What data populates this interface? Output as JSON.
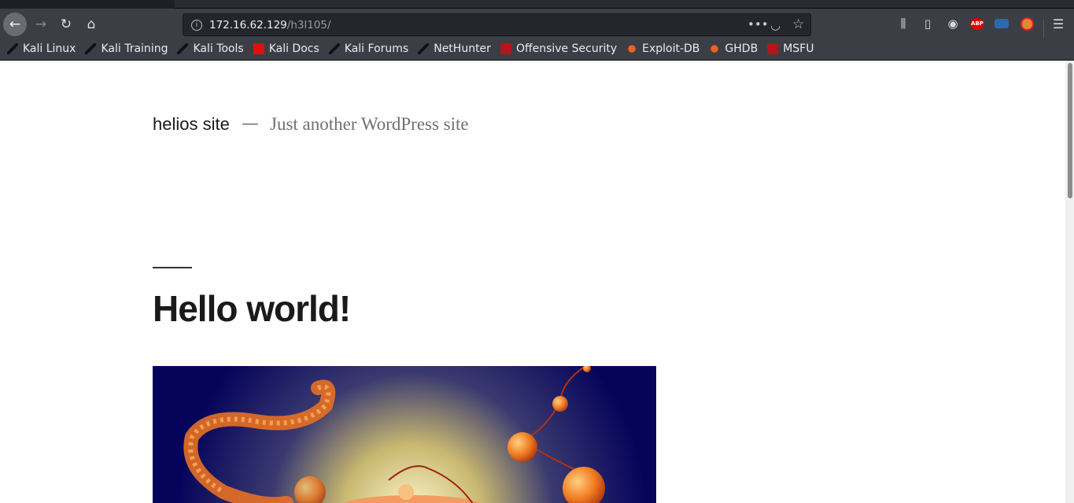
{
  "browser": {
    "url_host": "172.16.62.129",
    "url_path": "/h3l105/",
    "bookmarks": [
      {
        "label": "Kali Linux",
        "icon": "kali-dragon-icon"
      },
      {
        "label": "Kali Training",
        "icon": "kali-dragon-icon"
      },
      {
        "label": "Kali Tools",
        "icon": "kali-dragon-icon"
      },
      {
        "label": "Kali Docs",
        "icon": "kali-docs-icon"
      },
      {
        "label": "Kali Forums",
        "icon": "kali-dragon-icon"
      },
      {
        "label": "NetHunter",
        "icon": "kali-dragon-icon"
      },
      {
        "label": "Offensive Security",
        "icon": "offsec-icon"
      },
      {
        "label": "Exploit-DB",
        "icon": "exploit-db-icon"
      },
      {
        "label": "GHDB",
        "icon": "exploit-db-icon"
      },
      {
        "label": "MSFU",
        "icon": "offsec-icon"
      }
    ],
    "abp_label": "ABP"
  },
  "site": {
    "title": "helios site",
    "separator": "—",
    "tagline": "Just another WordPress site"
  },
  "post": {
    "title": "Hello world!"
  },
  "colors": {
    "image_background": "#05035a",
    "accent_orange": "#f07a20"
  }
}
